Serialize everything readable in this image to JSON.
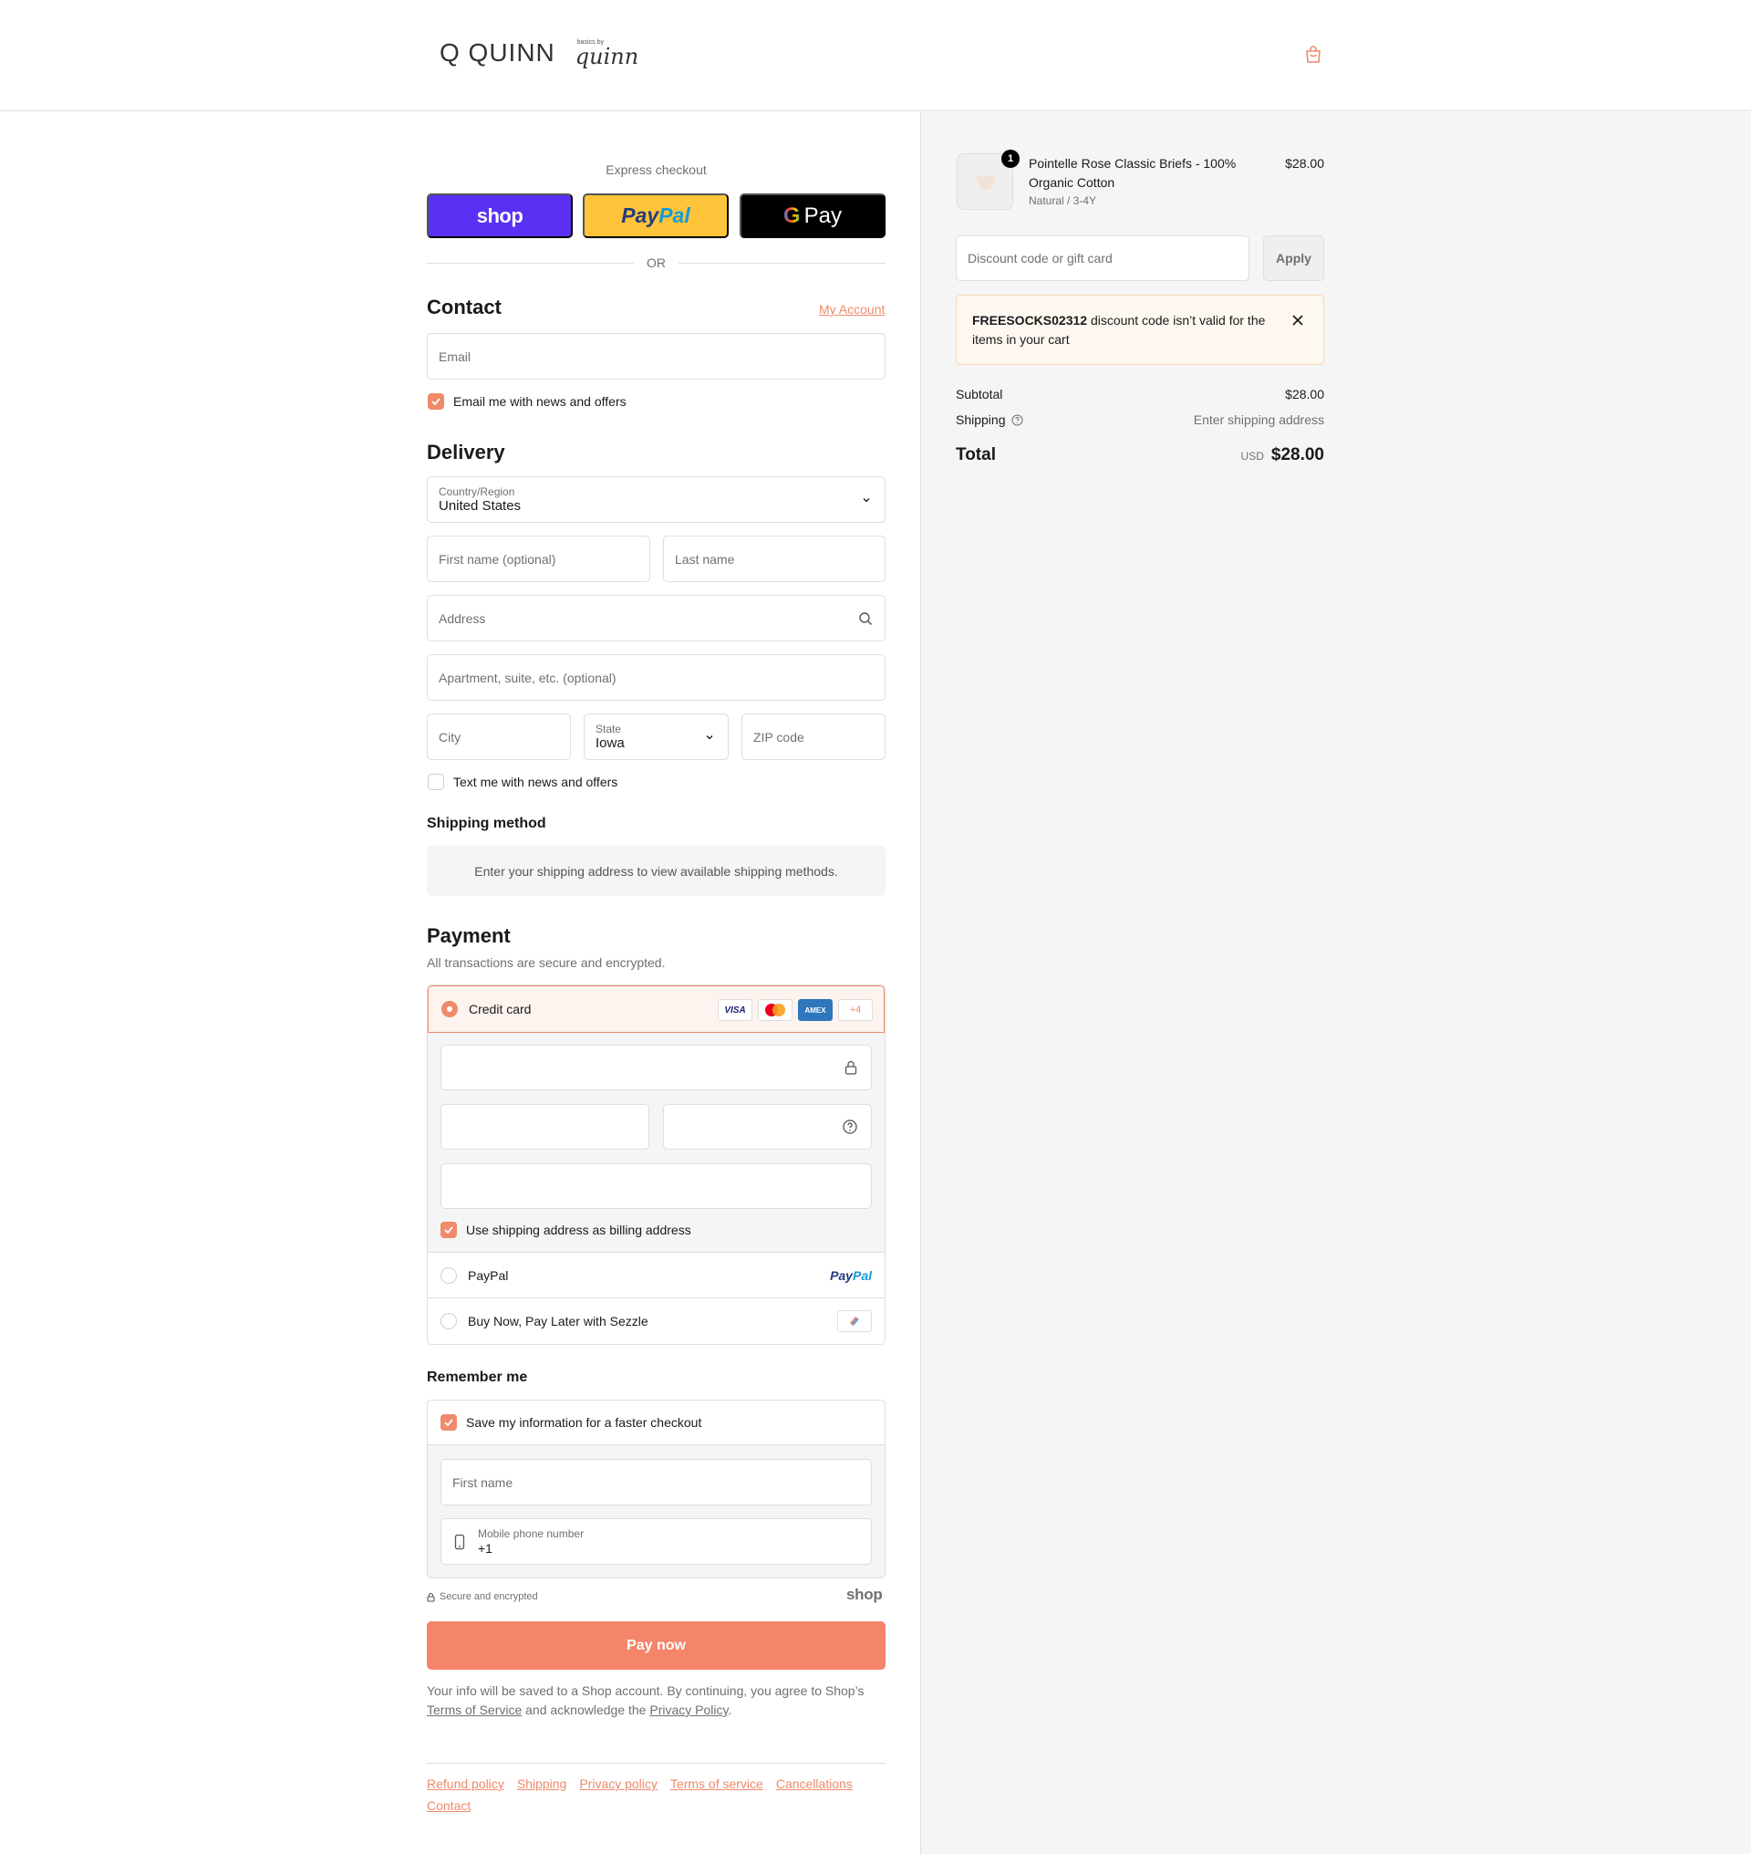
{
  "brand": {
    "logo_text": "Q QUINN",
    "sub_small": "basics by",
    "sub_script": "quinn"
  },
  "express": {
    "title": "Express checkout",
    "shop_label": "shop",
    "paypal_label_1": "Pay",
    "paypal_label_2": "Pal",
    "gpay_g": "G",
    "gpay_label": "Pay",
    "or_label": "OR"
  },
  "contact": {
    "title": "Contact",
    "account_link": "My Account",
    "email_placeholder": "Email",
    "news_label": "Email me with news and offers",
    "news_checked": true
  },
  "delivery": {
    "title": "Delivery",
    "country_label": "Country/Region",
    "country_value": "United States",
    "first_name_placeholder": "First name (optional)",
    "last_name_placeholder": "Last name",
    "address_placeholder": "Address",
    "apartment_placeholder": "Apartment, suite, etc. (optional)",
    "city_placeholder": "City",
    "state_label": "State",
    "state_value": "Iowa",
    "zip_placeholder": "ZIP code",
    "text_label": "Text me with news and offers",
    "text_checked": false
  },
  "shipping_method": {
    "title": "Shipping method",
    "message": "Enter your shipping address to view available shipping methods."
  },
  "payment": {
    "title": "Payment",
    "subtitle": "All transactions are secure and encrypted.",
    "credit_card_label": "Credit card",
    "card_visa": "VISA",
    "card_amex": "AMEX",
    "card_more": "+4",
    "billing_label": "Use shipping address as billing address",
    "paypal_label": "PayPal",
    "paypal_logo_1": "Pay",
    "paypal_logo_2": "Pal",
    "sezzle_label": "Buy Now, Pay Later with Sezzle"
  },
  "remember": {
    "title": "Remember me",
    "save_label": "Save my information for a faster checkout",
    "first_name_placeholder": "First name",
    "phone_label": "Mobile phone number",
    "phone_value": "+1"
  },
  "secure": {
    "label": "Secure and encrypted",
    "shop_word": "shop"
  },
  "pay_now_label": "Pay now",
  "legal": {
    "text_1": "Your info will be saved to a Shop account. By continuing, you agree to Shop’s ",
    "terms_link": "Terms of Service",
    "text_2": " and acknowledge the ",
    "privacy_link": "Privacy Policy",
    "text_3": "."
  },
  "footer_links": [
    "Refund policy",
    "Shipping",
    "Privacy policy",
    "Terms of service",
    "Cancellations",
    "Contact"
  ],
  "cart": {
    "quantity": "1",
    "product_name": "Pointelle Rose Classic Briefs - 100% Organic Cotton",
    "variant": "Natural / 3-4Y",
    "price": "$28.00",
    "discount_placeholder": "Discount code or gift card",
    "apply_label": "Apply",
    "alert_code": "FREESOCKS02312",
    "alert_text": " discount code isn’t valid for the items in your cart",
    "subtotal_label": "Subtotal",
    "subtotal_value": "$28.00",
    "shipping_label": "Shipping",
    "shipping_value": "Enter shipping address",
    "total_label": "Total",
    "currency": "USD",
    "total_value": "$28.00"
  },
  "colors": {
    "accent": "#ef8a6b",
    "pay_button": "#f4846a",
    "shop_purple": "#5a31f4",
    "paypal_yellow": "#ffc439"
  }
}
